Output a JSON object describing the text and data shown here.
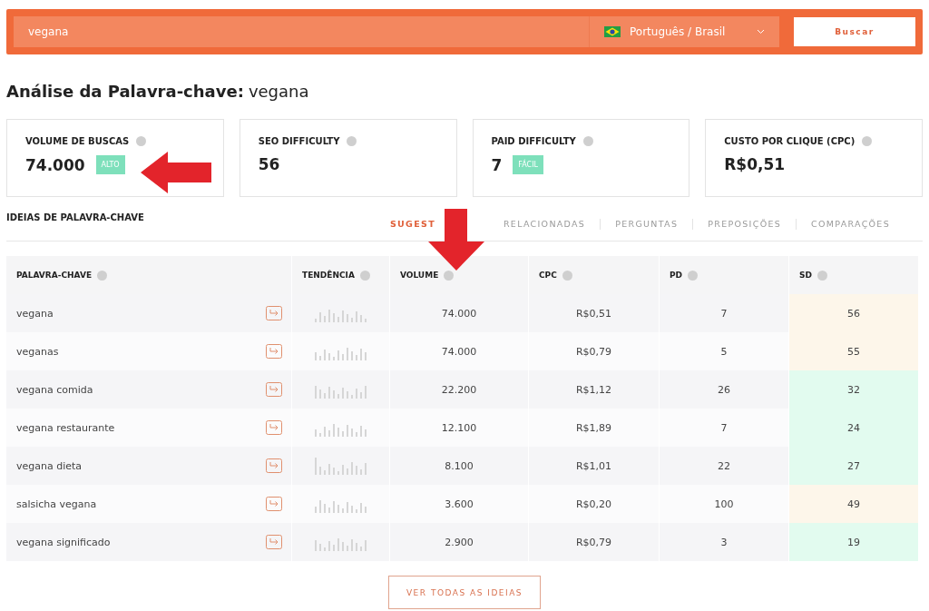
{
  "search": {
    "value": "vegana",
    "language": "Português / Brasil",
    "button": "Buscar"
  },
  "heading": {
    "label": "Análise da Palavra-chave:",
    "keyword": "vegana"
  },
  "metrics": [
    {
      "title": "VOLUME DE BUSCAS",
      "value": "74.000",
      "badge": "ALTO"
    },
    {
      "title": "SEO DIFFICULTY",
      "value": "56"
    },
    {
      "title": "PAID DIFFICULTY",
      "value": "7",
      "badge": "FÁCIL"
    },
    {
      "title": "CUSTO POR CLIQUE (CPC)",
      "value": "R$0,51"
    }
  ],
  "ideas": {
    "title": "IDEIAS DE PALAVRA-CHAVE",
    "tabs": [
      {
        "label": "SUGEST",
        "selected": true
      },
      {
        "label": "RELACIONADAS",
        "selected": false
      },
      {
        "label": "PERGUNTAS",
        "selected": false
      },
      {
        "label": "PREPOSIÇÕES",
        "selected": false
      },
      {
        "label": "COMPARAÇÕES",
        "selected": false
      }
    ]
  },
  "table": {
    "columns": [
      "PALAVRA-CHAVE",
      "TENDÊNCIA",
      "VOLUME",
      "CPC",
      "PD",
      "SD"
    ],
    "rows": [
      {
        "keyword": "vegana",
        "volume": "74.000",
        "cpc": "R$0,51",
        "pd": "7",
        "sd": "56",
        "color": "#fdf6ea"
      },
      {
        "keyword": "veganas",
        "volume": "74.000",
        "cpc": "R$0,79",
        "pd": "5",
        "sd": "55",
        "color": "#fdf6ea"
      },
      {
        "keyword": "vegana comida",
        "volume": "22.200",
        "cpc": "R$1,12",
        "pd": "26",
        "sd": "32",
        "color": "#e2fbef"
      },
      {
        "keyword": "vegana restaurante",
        "volume": "12.100",
        "cpc": "R$1,89",
        "pd": "7",
        "sd": "24",
        "color": "#e2fbef"
      },
      {
        "keyword": "vegana dieta",
        "volume": "8.100",
        "cpc": "R$1,01",
        "pd": "22",
        "sd": "27",
        "color": "#e2fbef"
      },
      {
        "keyword": "salsicha vegana",
        "volume": "3.600",
        "cpc": "R$0,20",
        "pd": "100",
        "sd": "49",
        "color": "#fdf6ea"
      },
      {
        "keyword": "vegana significado",
        "volume": "2.900",
        "cpc": "R$0,79",
        "pd": "3",
        "sd": "19",
        "color": "#e2fbef"
      }
    ]
  },
  "more_button": "VER TODAS AS IDEIAS"
}
